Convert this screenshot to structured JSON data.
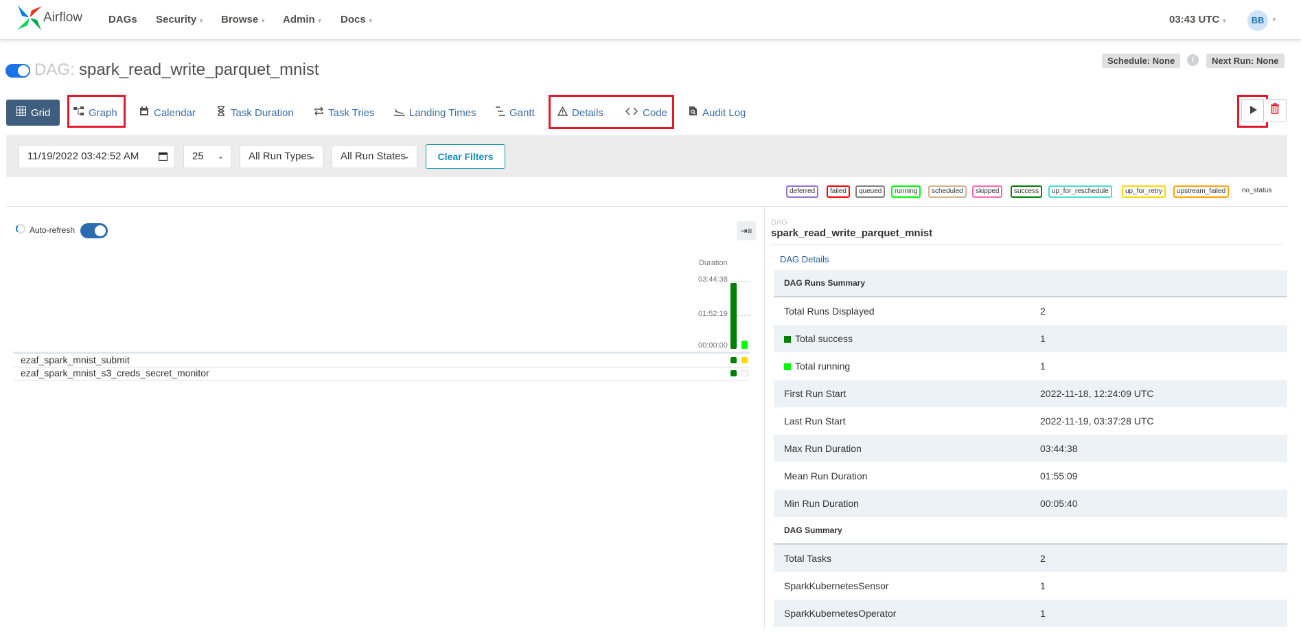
{
  "nav": {
    "brand": "Airflow",
    "items": [
      {
        "label": "DAGs",
        "caret": ""
      },
      {
        "label": "Security",
        "caret": "▼"
      },
      {
        "label": "Browse",
        "caret": "▼"
      },
      {
        "label": "Admin",
        "caret": "▼"
      },
      {
        "label": "Docs",
        "caret": "▼"
      }
    ],
    "clock": "03:43 UTC",
    "clock_caret": "▼",
    "avatar": "BB",
    "avatar_caret": "▼"
  },
  "dag": {
    "prefix": "DAG:",
    "name": "spark_read_write_parquet_mnist",
    "schedule": "Schedule: None",
    "next_run": "Next Run: None",
    "paused": false
  },
  "tabs": [
    {
      "label": "Grid",
      "icon": "grid-icon",
      "active": true
    },
    {
      "label": "Graph",
      "icon": "graph-icon"
    },
    {
      "label": "Calendar",
      "icon": "calendar-icon"
    },
    {
      "label": "Task Duration",
      "icon": "hourglass-icon"
    },
    {
      "label": "Task Tries",
      "icon": "repeat-icon"
    },
    {
      "label": "Landing Times",
      "icon": "plane-landing-icon"
    },
    {
      "label": "Gantt",
      "icon": "gantt-icon"
    },
    {
      "label": "Details",
      "icon": "warning-icon"
    },
    {
      "label": "Code",
      "icon": "code-icon"
    },
    {
      "label": "Audit Log",
      "icon": "file-search-icon"
    }
  ],
  "actions": {
    "trigger_icon": "play-icon",
    "delete_icon": "trash-icon"
  },
  "filters": {
    "datetime": "11/19/2022 03:42:52 AM",
    "num_runs": "25",
    "run_type": "All Run Types",
    "run_state": "All Run States",
    "clear": "Clear Filters"
  },
  "legend": [
    {
      "label": "deferred",
      "color": "#9370db"
    },
    {
      "label": "failed",
      "color": "#ff0000"
    },
    {
      "label": "queued",
      "color": "#808080"
    },
    {
      "label": "running",
      "color": "#00ff00"
    },
    {
      "label": "scheduled",
      "color": "#d2b48c"
    },
    {
      "label": "skipped",
      "color": "#ff69b4"
    },
    {
      "label": "success",
      "color": "#008000"
    },
    {
      "label": "up_for_reschedule",
      "color": "#40e0d0"
    },
    {
      "label": "up_for_retry",
      "color": "#ffd700"
    },
    {
      "label": "upstream_failed",
      "color": "#ffa500"
    },
    {
      "label": "no_status",
      "color": ""
    }
  ],
  "grid": {
    "auto_refresh_label": "Auto-refresh",
    "auto_refresh_on": true,
    "duration_label": "Duration",
    "duration_ticks": [
      "03:44:38",
      "01:52:19",
      "00:00:00"
    ],
    "runs": [
      {
        "state": "success",
        "duration": "03:44:38",
        "color": "#008000"
      },
      {
        "state": "running",
        "duration": "00:05:40",
        "color": "#00ff00"
      }
    ],
    "tasks": [
      {
        "name": "ezaf_spark_mnist_submit",
        "states": [
          "success",
          "up_for_retry"
        ],
        "colors": [
          "#008000",
          "#ffd700"
        ]
      },
      {
        "name": "ezaf_spark_mnist_s3_creds_secret_monitor",
        "states": [
          "success",
          "no_status"
        ],
        "colors": [
          "#008000",
          ""
        ]
      }
    ]
  },
  "details": {
    "kind": "DAG",
    "title": "spark_read_write_parquet_mnist",
    "link": "DAG Details",
    "runs_summary_header": "DAG Runs Summary",
    "runs_summary": [
      {
        "key": "Total Runs Displayed",
        "value": "2"
      },
      {
        "key": "Total success",
        "value": "1",
        "mark": "#008000"
      },
      {
        "key": "Total running",
        "value": "1",
        "mark": "#00ff00"
      },
      {
        "key": "First Run Start",
        "value": "2022-11-18, 12:24:09 UTC"
      },
      {
        "key": "Last Run Start",
        "value": "2022-11-19, 03:37:28 UTC"
      },
      {
        "key": "Max Run Duration",
        "value": "03:44:38"
      },
      {
        "key": "Mean Run Duration",
        "value": "01:55:09"
      },
      {
        "key": "Min Run Duration",
        "value": "00:05:40"
      }
    ],
    "dag_summary_header": "DAG Summary",
    "dag_summary": [
      {
        "key": "Total Tasks",
        "value": "2"
      },
      {
        "key": "SparkKubernetesSensor",
        "value": "1"
      },
      {
        "key": "SparkKubernetesOperator",
        "value": "1"
      }
    ]
  }
}
